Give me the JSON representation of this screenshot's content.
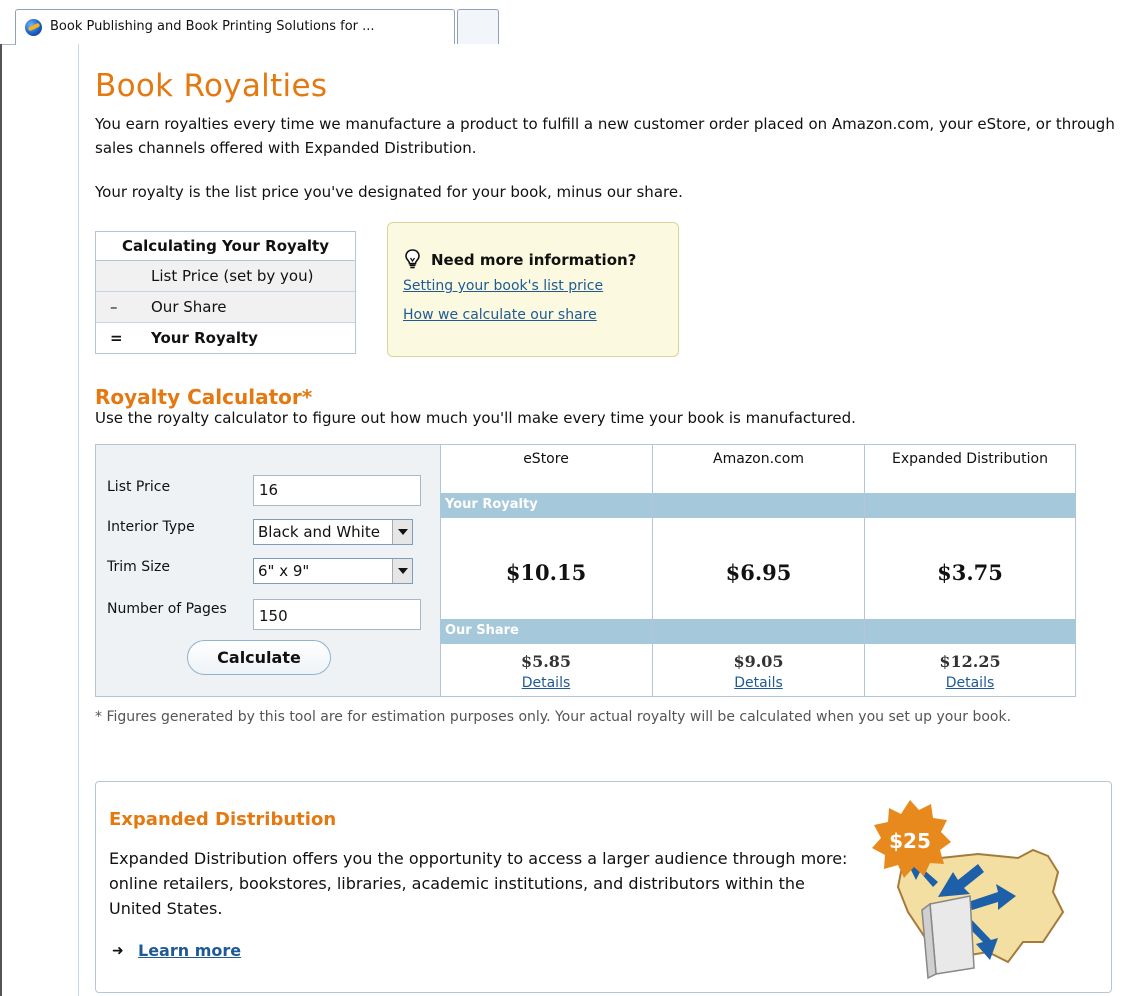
{
  "browser": {
    "tab_title": "Book Publishing and Book Printing Solutions for ..."
  },
  "page": {
    "title": "Book Royalties",
    "intro": "You earn royalties every time we manufacture a product to fulfill a new customer order placed on Amazon.com, your eStore, or through sales channels offered with Expanded Distribution.",
    "intro2": "Your royalty is the list price you've designated for your book, minus our share."
  },
  "calc_table": {
    "header": "Calculating Your Royalty",
    "rows": [
      {
        "op": "",
        "label": "List Price (set by you)"
      },
      {
        "op": "–",
        "label": "Our Share"
      },
      {
        "op": "=",
        "label": "Your Royalty"
      }
    ]
  },
  "info": {
    "title": "Need more information?",
    "link1": "Setting your book's list price",
    "link2": "How we calculate our share"
  },
  "calculator": {
    "title": "Royalty Calculator*",
    "description": "Use the royalty calculator to figure out how much you'll make every time your book is manufactured.",
    "fields": {
      "list_price_label": "List Price",
      "list_price_value": "16",
      "interior_label": "Interior Type",
      "interior_value": "Black and White",
      "trim_label": "Trim Size",
      "trim_value": "6\" x 9\"",
      "pages_label": "Number of Pages",
      "pages_value": "150"
    },
    "button": "Calculate",
    "columns": [
      "eStore",
      "Amazon.com",
      "Expanded Distribution"
    ],
    "royalty_label": "Your Royalty",
    "share_label": "Our Share",
    "royalties": [
      "$10.15",
      "$6.95",
      "$3.75"
    ],
    "shares": [
      "$5.85",
      "$9.05",
      "$12.25"
    ],
    "details_label": "Details"
  },
  "footnote": "* Figures generated by this tool are for estimation purposes only. Your actual royalty will be calculated when you set up your book.",
  "expanded": {
    "title": "Expanded Distribution",
    "text": "Expanded Distribution offers you the opportunity to access a larger audience through more: online retailers, bookstores, libraries, academic institutions, and distributors within the United States.",
    "learn_more": "Learn more",
    "badge": "$25"
  },
  "colors": {
    "accent_orange": "#e47911",
    "link_blue": "#1f5a94",
    "band_blue": "#a6c8db"
  }
}
